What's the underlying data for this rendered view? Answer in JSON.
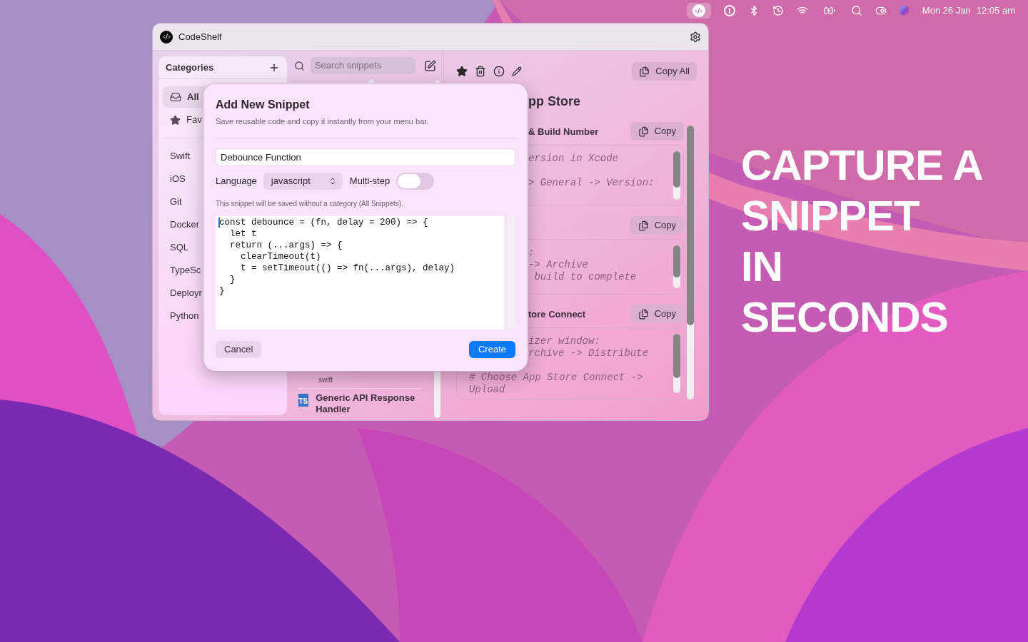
{
  "menu_bar": {
    "date": "Mon 26 Jan",
    "time": "12:05 am"
  },
  "window": {
    "title": "CodeShelf"
  },
  "sidebar": {
    "title": "Categories",
    "items": [
      {
        "label": "All",
        "selected": true,
        "kind": "inbox"
      },
      {
        "label": "Fav",
        "selected": false,
        "kind": "star"
      },
      {
        "label": "Swift",
        "selected": false,
        "kind": "plain"
      },
      {
        "label": "iOS",
        "selected": false,
        "kind": "plain"
      },
      {
        "label": "Git",
        "selected": false,
        "kind": "plain"
      },
      {
        "label": "Docker",
        "selected": false,
        "kind": "plain"
      },
      {
        "label": "SQL",
        "selected": false,
        "kind": "plain"
      },
      {
        "label": "TypeSc",
        "selected": false,
        "kind": "plain"
      },
      {
        "label": "Deployr",
        "selected": false,
        "kind": "plain"
      },
      {
        "label": "Python",
        "selected": false,
        "kind": "plain"
      }
    ]
  },
  "search": {
    "placeholder": "Search snippets"
  },
  "snippet_list": {
    "previous_language": "swift",
    "items": [
      {
        "title": "Generic API Response Handler",
        "badge": "TS"
      }
    ]
  },
  "detail": {
    "title": "pp Store",
    "copy_all": "Copy All",
    "steps": [
      {
        "title": "& Build Number",
        "copy": "Copy",
        "code": [
          {
            "text": "ersion in Xcode",
            "gap": false,
            "full": false
          },
          {
            "text": "> General -> Version:",
            "gap": true,
            "full": false
          }
        ]
      },
      {
        "copy": "Copy",
        "code": [
          {
            "text": ":",
            "gap": false,
            "full": false
          },
          {
            "text": "-> Archive",
            "gap": false,
            "full": false
          },
          {
            "text": " build to complete",
            "gap": false,
            "full": false
          }
        ]
      },
      {
        "title": "tore Connect",
        "copy": "Copy",
        "code": [
          {
            "text": "izer window:",
            "gap": false,
            "full": false
          },
          {
            "text": "rchive -> Distribute",
            "gap": false,
            "full": false
          },
          {
            "text": "# Choose App Store Connect -> Upload",
            "gap": true,
            "full": true
          }
        ]
      }
    ]
  },
  "sheet": {
    "title": "Add New Snippet",
    "subtitle": "Save reusable code and copy it instantly from your menu bar.",
    "name": "Debounce Function",
    "language_label": "Language",
    "language": "javascript",
    "multistep_label": "Multi-step",
    "multistep_on": false,
    "note": "This snippet will be saved without a category (All Snippets).",
    "code": "const debounce = (fn, delay = 200) => {\n  let t\n  return (...args) => {\n    clearTimeout(t)\n    t = setTimeout(() => fn(...args), delay)\n  }\n}",
    "cancel": "Cancel",
    "create": "Create"
  },
  "promo": [
    "CAPTURE A",
    "SNIPPET",
    "IN",
    "SECONDS"
  ]
}
